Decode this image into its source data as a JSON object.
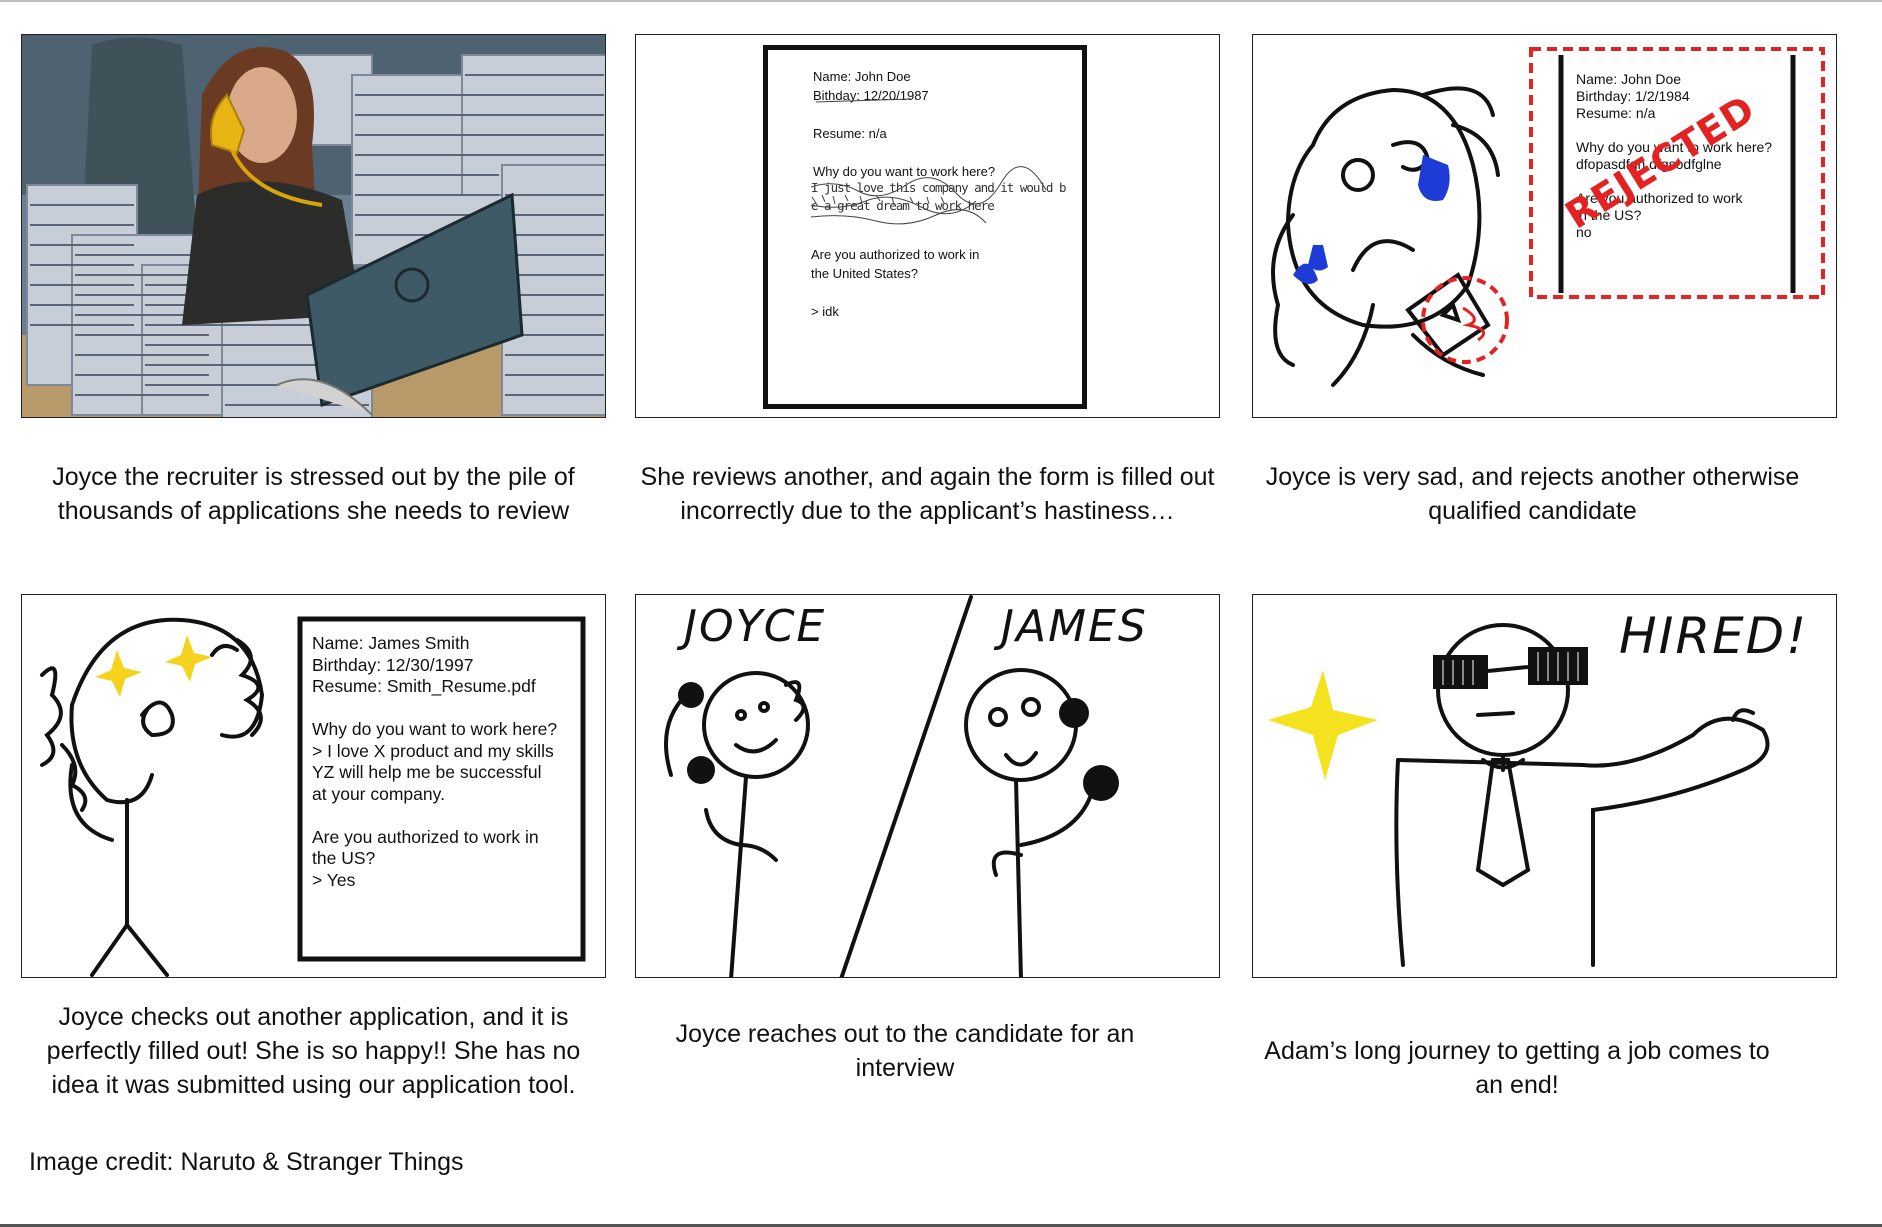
{
  "panels": [
    {
      "caption": "Joyce the recruiter is stressed out by the pile of thousands of applications she needs to review"
    },
    {
      "caption": "She reviews another, and again the form is filled out incorrectly due to the applicant’s hastiness…",
      "form": {
        "name": "Name: John Doe",
        "birthday": "Bithday: 12/20/1987",
        "resume": "Resume: n/a",
        "question1": "Why do you want to work here?",
        "answer1_line1": "I just love this company and it would b",
        "answer1_line2": "e a great dream to work here",
        "question2_line1": "Are you authorized to work in",
        "question2_line2": "the United States?",
        "answer2": "> idk"
      }
    },
    {
      "caption": "Joyce is very sad, and rejects another otherwise qualified candidate",
      "form": {
        "name": "Name: John Doe",
        "birthday": "Birthday: 1/2/1984",
        "resume": "Resume: n/a",
        "question1": "Why do you want to work here?",
        "answer1": "dfopasdfgh dfgsodfglne",
        "question2_line1": "Are you authorized to work",
        "question2_line2": "in the US?",
        "answer2": "no"
      },
      "stamp": "REJECTED"
    },
    {
      "caption": "Joyce checks out another application, and it is perfectly filled out! She is so happy!! She has no idea it was submitted using our application tool.",
      "form": {
        "name": "Name: James Smith",
        "birthday": "Birthday: 12/30/1997",
        "resume": "Resume: Smith_Resume.pdf",
        "question1": "Why do you want to work here?",
        "answer1_line1": "> I love X product and my skills",
        "answer1_line2": "YZ will help me be successful",
        "answer1_line3": "at your company.",
        "question2_line1": "Are you authorized to work in",
        "question2_line2": "the US?",
        "answer2": "> Yes"
      }
    },
    {
      "caption": "Joyce reaches out to the candidate for an interview",
      "label_left": "JOYCE",
      "label_right": "JAMES"
    },
    {
      "caption": "Adam’s long journey to getting a job comes to an end!",
      "label": "HIRED!"
    }
  ],
  "credit": "Image credit: Naruto & Stranger Things",
  "colors": {
    "stamp_red": "#e32222",
    "tear_blue": "#1f3bd6",
    "star_yellow": "#f5d21e",
    "paper_gray": "#8f9cad"
  }
}
